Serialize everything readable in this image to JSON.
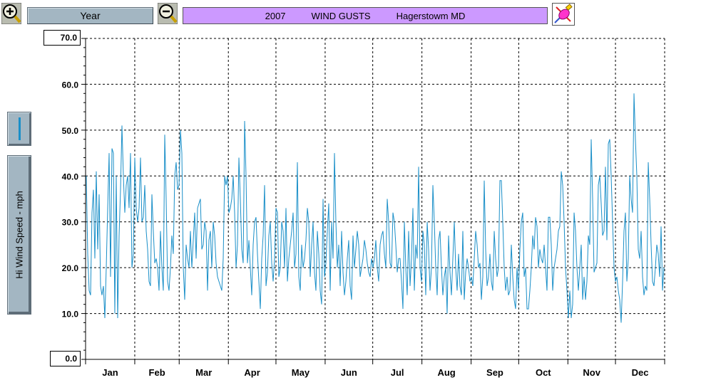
{
  "toolbar": {
    "zoom_in_icon": "zoom-in-icon",
    "zoom_out_icon": "zoom-out-icon",
    "period_label": "Year",
    "title_year": "2007",
    "title_name": "WIND GUSTS",
    "title_location": "Hagerstowm MD",
    "pencil_icon": "pencil-eraser-icon",
    "title_bg": "#cc99ff",
    "button_bg": "#a3b6c2"
  },
  "sidebar": {
    "ylabel": "Hi Wind Speed - mph",
    "legend_color": "#1a8fc8"
  },
  "chart_data": {
    "type": "line",
    "ylabel": "Hi Wind Speed - mph",
    "ylim": [
      0,
      70
    ],
    "yticks": [
      "0.0",
      "10.0",
      "20.0",
      "30.0",
      "40.0",
      "50.0",
      "60.0",
      "70.0"
    ],
    "ymax_label": "70.0",
    "ymin_label": "0.0",
    "grid": true,
    "months": [
      "Jan",
      "Feb",
      "Mar",
      "Apr",
      "May",
      "Jun",
      "Jul",
      "Aug",
      "Sep",
      "Oct",
      "Nov",
      "Dec"
    ],
    "x_unit": "day of year",
    "series": [
      {
        "color": "#1a8fc8",
        "values": [
          40,
          23,
          15,
          14,
          32,
          37,
          22,
          41,
          24,
          36,
          16,
          14,
          16,
          9,
          20,
          33,
          45,
          18,
          46,
          45,
          10,
          40,
          9,
          27,
          37,
          51,
          40,
          32,
          38,
          40,
          33,
          45,
          20,
          23,
          44,
          33,
          30,
          33,
          44,
          30,
          31,
          38,
          28,
          24,
          17,
          16,
          36,
          28,
          21,
          22,
          20,
          15,
          28,
          20,
          15,
          49,
          35,
          17,
          15,
          20,
          27,
          23,
          40,
          43,
          37,
          38,
          50,
          45,
          20,
          13,
          25,
          22,
          20,
          28,
          20,
          26,
          32,
          22,
          33,
          34,
          35,
          24,
          25,
          30,
          28,
          15,
          26,
          28,
          20,
          30,
          27,
          21,
          18,
          17,
          16,
          15,
          22,
          40,
          38,
          40,
          32,
          33,
          35,
          40,
          32,
          20,
          25,
          44,
          35,
          24,
          21,
          52,
          40,
          21,
          26,
          20,
          14,
          25,
          30,
          31,
          23,
          17,
          11,
          22,
          27,
          38,
          16,
          19,
          27,
          30,
          21,
          17,
          22,
          33,
          32,
          18,
          20,
          30,
          28,
          20,
          33,
          17,
          22,
          25,
          28,
          32,
          20,
          23,
          43,
          18,
          15,
          25,
          20,
          22,
          26,
          33,
          30,
          18,
          25,
          30,
          19,
          15,
          28,
          23,
          15,
          12,
          35,
          18,
          21,
          28,
          34,
          15,
          30,
          22,
          45,
          30,
          20,
          25,
          16,
          28,
          19,
          14,
          17,
          22,
          26,
          16,
          13,
          27,
          20,
          24,
          28,
          25,
          18,
          20,
          22,
          26,
          24,
          21,
          19,
          18,
          22,
          20,
          22,
          26,
          20,
          17,
          25,
          27,
          28,
          23,
          20,
          35,
          30,
          21,
          20,
          32,
          30,
          25,
          19,
          22,
          22,
          17,
          11,
          30,
          20,
          14,
          28,
          16,
          22,
          33,
          15,
          25,
          22,
          42,
          20,
          17,
          28,
          25,
          14,
          30,
          24,
          15,
          20,
          38,
          30,
          20,
          14,
          26,
          28,
          20,
          14,
          18,
          20,
          10,
          27,
          19,
          14,
          22,
          30,
          20,
          15,
          23,
          16,
          14,
          28,
          13,
          19,
          22,
          20,
          17,
          18,
          16,
          22,
          28,
          25,
          20,
          21,
          13,
          18,
          39,
          24,
          16,
          18,
          23,
          17,
          15,
          28,
          22,
          18,
          20,
          39,
          39,
          30,
          20,
          15,
          18,
          14,
          15,
          25,
          18,
          13,
          11,
          20,
          15,
          24,
          30,
          32,
          18,
          20,
          11,
          11,
          15,
          20,
          27,
          24,
          31,
          29,
          20,
          24,
          22,
          21,
          25,
          20,
          15,
          31,
          31,
          25,
          15,
          20,
          22,
          24,
          28,
          29,
          41,
          38,
          30,
          20,
          15,
          9,
          15,
          9,
          12,
          32,
          28,
          20,
          15,
          20,
          25,
          13,
          18,
          13,
          17,
          27,
          25,
          48,
          35,
          19,
          20,
          21,
          38,
          40,
          34,
          27,
          28,
          42,
          26,
          47,
          48,
          40,
          30,
          20,
          17,
          18,
          15,
          13,
          8,
          17,
          28,
          32,
          17,
          22,
          40,
          35,
          32,
          58,
          48,
          40,
          24,
          22,
          28,
          18,
          14,
          16,
          15,
          43,
          35,
          25,
          17,
          16,
          20,
          25,
          23,
          18,
          29,
          15,
          20
        ]
      }
    ]
  }
}
